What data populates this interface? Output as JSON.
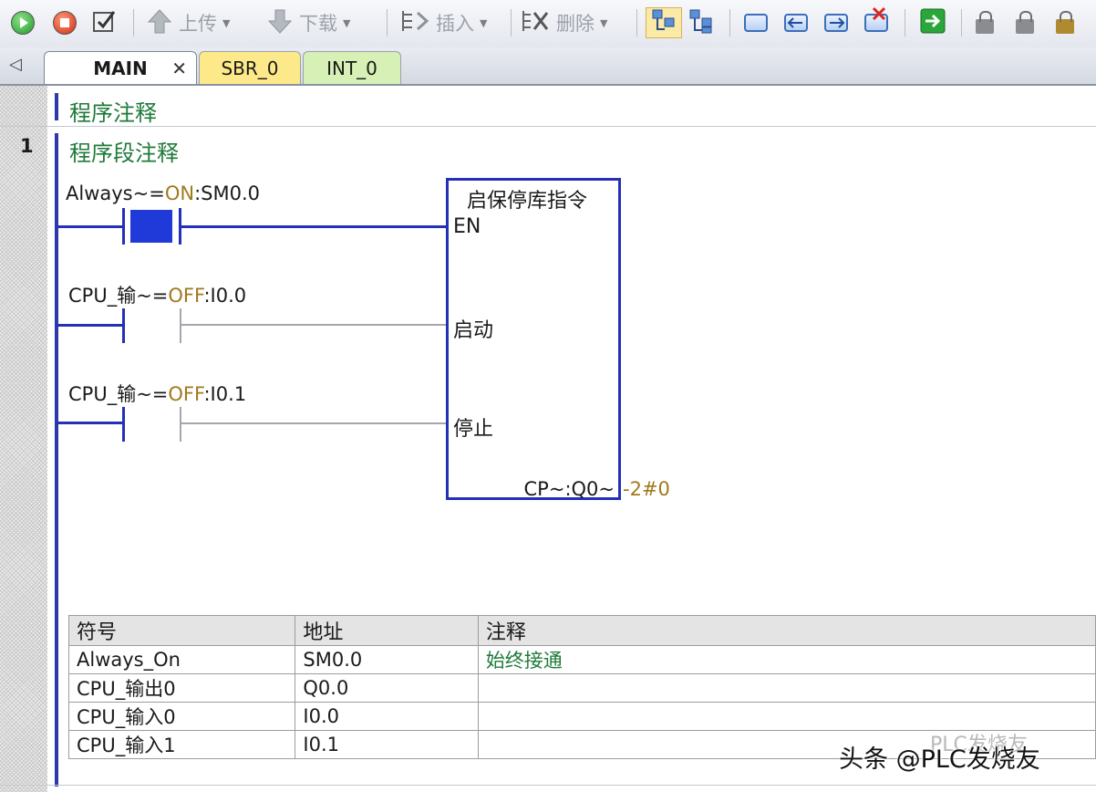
{
  "toolbar": {
    "upload_label": "上传",
    "download_label": "下载",
    "insert_label": "插入",
    "delete_label": "删除"
  },
  "tabs": [
    {
      "label": "MAIN",
      "active": true,
      "color": "#ffffff"
    },
    {
      "label": "SBR_0",
      "active": false,
      "color": "#fde98a"
    },
    {
      "label": "INT_0",
      "active": false,
      "color": "#d6f0b5"
    }
  ],
  "editor": {
    "program_comment": "程序注释",
    "network_number": "1",
    "network_comment": "程序段注释",
    "contacts": [
      {
        "prefix": "Always~=",
        "state": "ON",
        "address": ":SM0.0",
        "closed": true
      },
      {
        "prefix": "CPU_输~=",
        "state": "OFF",
        "address": ":I0.0",
        "closed": false
      },
      {
        "prefix": "CPU_输~=",
        "state": "OFF",
        "address": ":I0.1",
        "closed": false
      }
    ],
    "function_block": {
      "title": "启保停库指令",
      "inputs": [
        "EN",
        "启动",
        "停止"
      ],
      "output_label": "CP~:Q0~",
      "output_value": "-2#0"
    }
  },
  "symbol_table": {
    "headers": [
      "符号",
      "地址",
      "注释"
    ],
    "rows": [
      {
        "symbol": "Always_On",
        "address": "SM0.0",
        "comment": "始终接通"
      },
      {
        "symbol": "CPU_输出0",
        "address": "Q0.0",
        "comment": ""
      },
      {
        "symbol": "CPU_输入0",
        "address": "I0.0",
        "comment": ""
      },
      {
        "symbol": "CPU_输入1",
        "address": "I0.1",
        "comment": ""
      }
    ]
  },
  "watermark": {
    "text": "头条 @PLC发烧友",
    "ghost_text": "PLC发烧友"
  },
  "colors": {
    "rung": "#2530b8",
    "comment": "#1f7a3a",
    "state": "#a07a1e",
    "active_toolbar": "#fbe9a8"
  }
}
